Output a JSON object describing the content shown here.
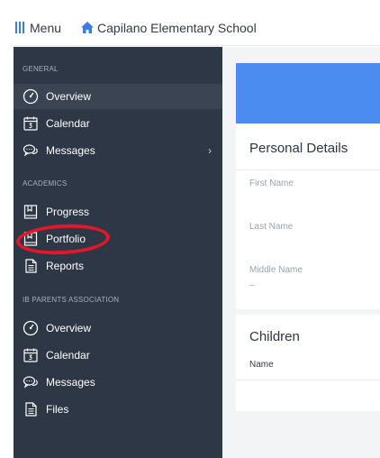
{
  "topbar": {
    "menu_label": "Menu",
    "school_name": "Capilano Elementary School",
    "accent": "#3b7de0"
  },
  "sidebar": {
    "sections": [
      {
        "title": "GENERAL",
        "items": [
          {
            "label": "Overview",
            "icon": "dashboard-gauge-icon",
            "active": true
          },
          {
            "label": "Calendar",
            "icon": "calendar-icon"
          },
          {
            "label": "Messages",
            "icon": "chat-bubbles-icon",
            "has_submenu": true
          }
        ]
      },
      {
        "title": "ACADEMICS",
        "items": [
          {
            "label": "Progress",
            "icon": "book-icon"
          },
          {
            "label": "Portfolio",
            "icon": "book-icon",
            "highlighted": true
          },
          {
            "label": "Reports",
            "icon": "document-icon"
          }
        ]
      },
      {
        "title": "IB PARENTS ASSOCIATION",
        "items": [
          {
            "label": "Overview",
            "icon": "dashboard-gauge-icon"
          },
          {
            "label": "Calendar",
            "icon": "calendar-icon"
          },
          {
            "label": "Messages",
            "icon": "chat-bubbles-icon"
          },
          {
            "label": "Files",
            "icon": "document-icon"
          }
        ]
      }
    ],
    "chevron": "›",
    "bg": "#2e3745",
    "annotation_color": "#e3172a"
  },
  "main": {
    "banner_color": "#4a8cf0",
    "personal": {
      "title": "Personal Details",
      "fields": [
        {
          "label": "First Name",
          "value": ""
        },
        {
          "label": "Last Name",
          "value": ""
        },
        {
          "label": "Middle Name",
          "value": "–"
        }
      ]
    },
    "children": {
      "title": "Children",
      "columns": [
        "Name"
      ]
    }
  }
}
